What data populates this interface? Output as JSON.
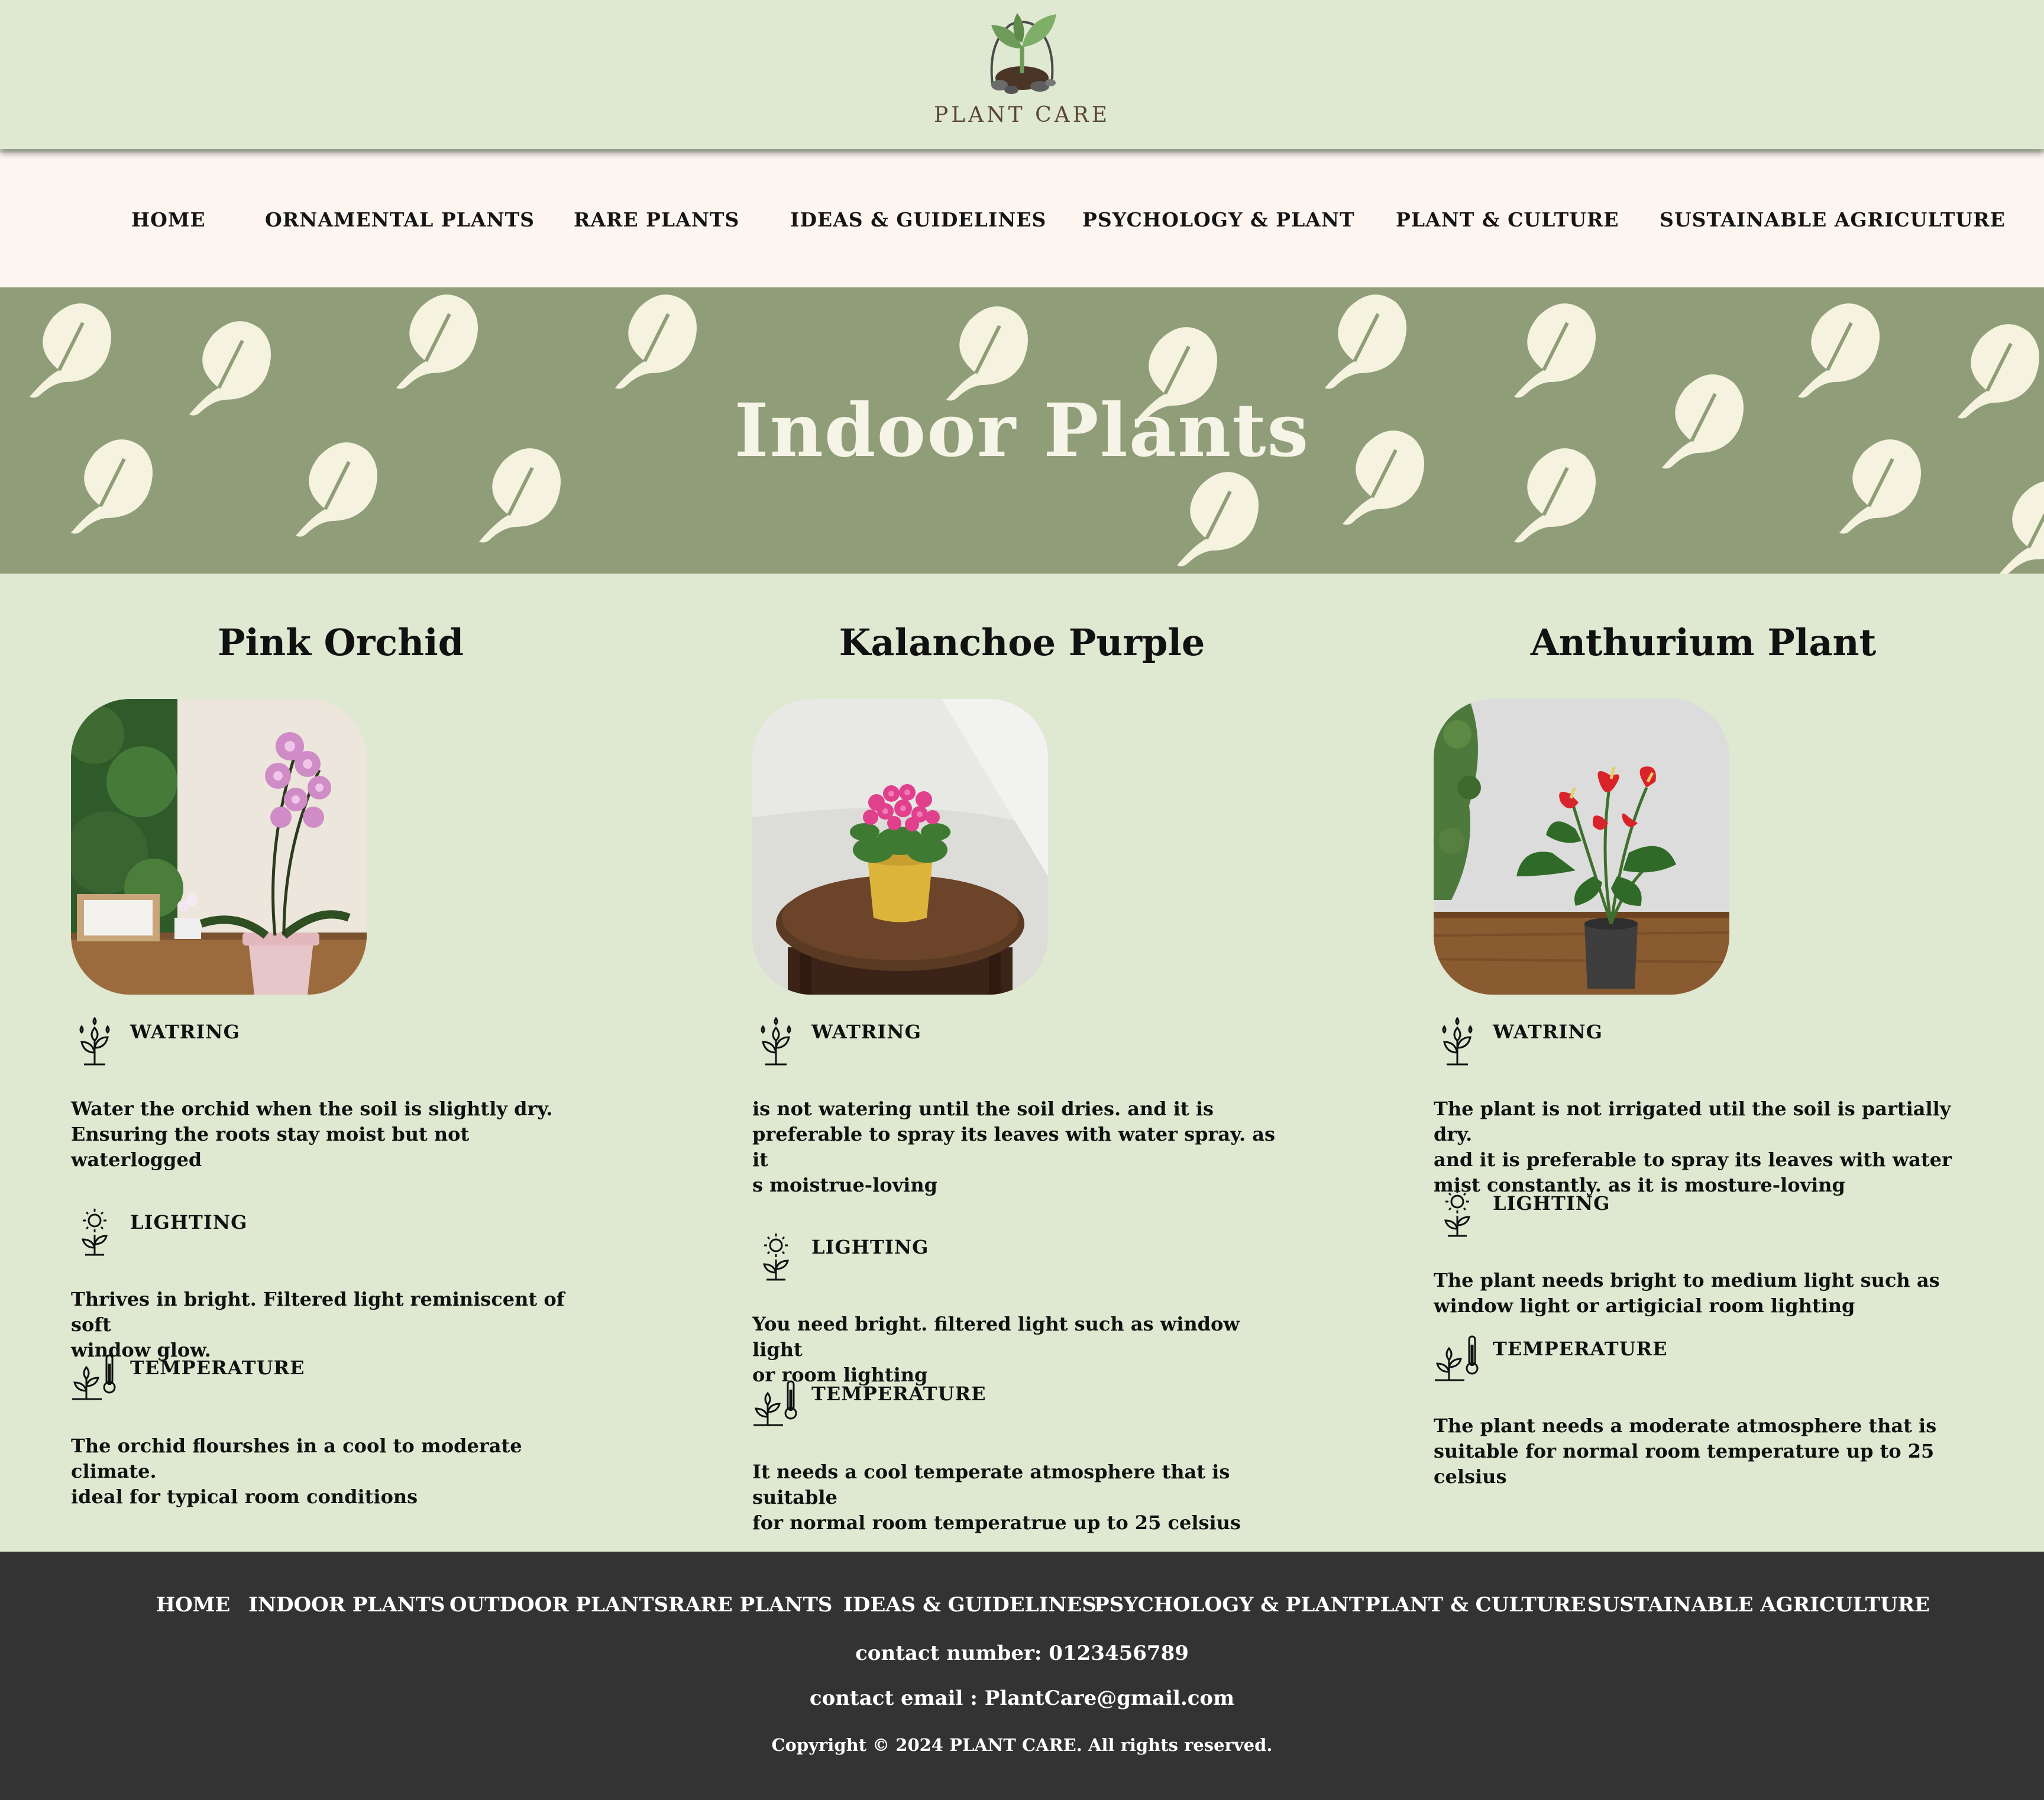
{
  "brand": {
    "name": "PLANT CARE"
  },
  "nav": {
    "items": [
      "HOME",
      "ORNAMENTAL PLANTS",
      "RARE PLANTS",
      "IDEAS & GUIDELINES",
      "PSYCHOLOGY & PLANT",
      "PLANT & CULTURE",
      "SUSTAINABLE AGRICULTURE"
    ]
  },
  "hero": {
    "title": "Indoor Plants"
  },
  "plants": [
    {
      "name": "Pink Orchid",
      "watering_label": "WATRING",
      "watering_lines": [
        "Water the orchid when the soil is slightly dry.",
        "Ensuring the roots stay moist but not waterlogged"
      ],
      "lighting_label": "LIGHTING",
      "lighting_lines": [
        "Thrives in bright. Filtered light reminiscent of soft",
        "window glow."
      ],
      "temperature_label": "TEMPERATURE",
      "temperature_lines": [
        "The orchid flourshes in a cool to moderate climate.",
        "ideal for typical room conditions"
      ]
    },
    {
      "name": "Kalanchoe Purple",
      "watering_label": "WATRING",
      "watering_lines": [
        "is not watering until the soil dries. and it is",
        "preferable to spray its leaves with water spray. as it",
        "s moistrue-loving"
      ],
      "lighting_label": "LIGHTING",
      "lighting_lines": [
        "You need bright. filtered light such as window light",
        "or room lighting"
      ],
      "temperature_label": "TEMPERATURE",
      "temperature_lines": [
        "It needs a cool temperate atmosphere that is suitable",
        "for normal room temperatrue up to 25 celsius"
      ]
    },
    {
      "name": "Anthurium Plant",
      "watering_label": "WATRING",
      "watering_lines": [
        "The plant is not irrigated util the soil is partially dry.",
        "and it is preferable to spray its leaves with water",
        "mist constantly. as it is mosture-loving"
      ],
      "lighting_label": "LIGHTING",
      "lighting_lines": [
        "The plant needs bright to medium light such as",
        "window light or artigicial room lighting"
      ],
      "temperature_label": "TEMPERATURE",
      "temperature_lines": [
        "The plant needs a moderate atmosphere that is",
        "suitable for normal room temperature up to 25",
        "celsius"
      ]
    }
  ],
  "footer": {
    "nav": [
      "HOME",
      "INDOOR PLANTS",
      "OUTDOOR PLANTS",
      "RARE PLANTS",
      "IDEAS & GUIDELINES",
      "PSYCHOLOGY & PLANT",
      "PLANT & CULTURE",
      "SUSTAINABLE AGRICULTURE"
    ],
    "contact_number": "contact number: 0123456789",
    "contact_email": "contact email : PlantCare@gmail.com",
    "copyright": "Copyright © 2024 PLANT CARE. All rights reserved."
  },
  "colors": {
    "page_background": "#dfe8d0",
    "nav_background": "#fdf6f0",
    "hero_background": "#8f9e78",
    "hero_text": "#f6f4e6",
    "footer_background": "#333333"
  },
  "icons": {
    "logo": "sprout-in-soil-icon",
    "watering": "watering-sprout-icon",
    "lighting": "sun-plant-icon",
    "temperature": "thermometer-plant-icon"
  }
}
